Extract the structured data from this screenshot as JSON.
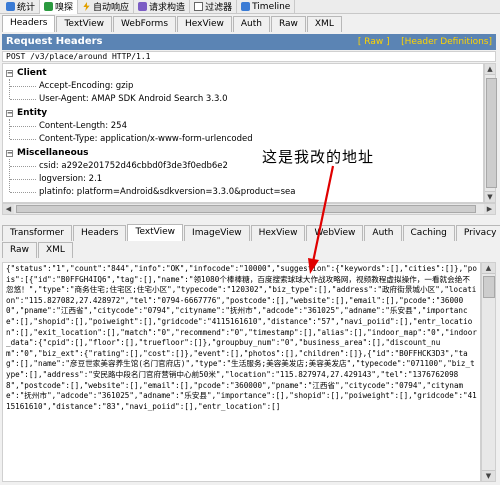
{
  "toolbar": {
    "items": [
      {
        "label": "统计",
        "icon": "stats-icon"
      },
      {
        "label": "嗅探",
        "icon": "inspect-icon",
        "active": true
      },
      {
        "label": "自动响应",
        "icon": "lightning-icon"
      },
      {
        "label": "请求构造",
        "icon": "composer-icon"
      },
      {
        "label": "过滤器",
        "icon": "checkbox-icon"
      },
      {
        "label": "Timeline",
        "icon": "timeline-icon"
      }
    ]
  },
  "request_tabs": [
    "Headers",
    "TextView",
    "WebForms",
    "HexView",
    "Auth",
    "Raw",
    "XML"
  ],
  "request_headers": {
    "title": "Request Headers",
    "raw_link": "[ Raw ]",
    "defs_link": "[Header Definitions]",
    "request_line": "POST /v3/place/around HTTP/1.1",
    "sections": [
      {
        "name": "Client",
        "items": [
          "Accept-Encoding: gzip",
          "User-Agent: AMAP SDK Android Search 3.3.0"
        ]
      },
      {
        "name": "Entity",
        "items": [
          "Content-Length: 254",
          "Content-Type: application/x-www-form-urlencoded"
        ]
      },
      {
        "name": "Miscellaneous",
        "items": [
          "csid: a292e201752d46cbbd0f3de3f0edb6e2",
          "logversion: 2.1",
          "platinfo: platform=Android&sdkversion=3.3.0&product=sea"
        ]
      }
    ]
  },
  "annotation": "这是我改的地址",
  "response_tabs_row1": [
    "Transformer",
    "Headers",
    "TextView",
    "ImageView",
    "HexView",
    "WebView",
    "Auth",
    "Caching",
    "Privacy"
  ],
  "response_tabs_row2": [
    "Raw",
    "XML"
  ],
  "response_body": "{\"status\":\"1\",\"count\":\"844\",\"info\":\"OK\",\"infocode\":\"10000\",\"suggestion\":{\"keywords\":[],\"cities\":[]},\"pois\":[{\"id\":\"B0FFGH4IQ6\",\"tag\":[],\"name\":\"领1080个棒棒糖，百度搜索球球大作战攻略网，视频教程虚拟操作，一看就会绝不忽悠！\",\"type\":\"商务住宅;住宅区;住宅小区\",\"typecode\":\"120302\",\"biz_type\":[],\"address\":\"政府街景城小区\",\"location\":\"115.827082,27.428972\",\"tel\":\"0794-6667776\",\"postcode\":[],\"website\":[],\"email\":[],\"pcode\":\"360000\",\"pname\":\"江西省\",\"citycode\":\"0794\",\"cityname\":\"抚州市\",\"adcode\":\"361025\",\"adname\":\"乐安县\",\"importance\":[],\"shopid\":[],\"poiweight\":[],\"gridcode\":\"4115161610\",\"distance\":\"57\",\"navi_poiid\":[],\"entr_location\":[],\"exit_location\":[],\"match\":\"0\",\"recommend\":\"0\",\"timestamp\":[],\"alias\":[],\"indoor_map\":\"0\",\"indoor_data\":{\"cpid\":[],\"floor\":[],\"truefloor\":[]},\"groupbuy_num\":\"0\",\"business_area\":[],\"discount_num\":\"0\",\"biz_ext\":{\"rating\":[],\"cost\":[]},\"event\":[],\"photos\":[],\"children\":[]},{\"id\":\"B0FFHCK3D3\",\"tag\":[],\"name\":\"彦豆世家美容养生馆(名门官府店)\",\"type\":\"生活服务;美容美发店;美容美发店\",\"typecode\":\"071100\",\"biz_type\":[],\"address\":\"安民路中段名门官府营销中心前50米\",\"location\":\"115.827974,27.429143\",\"tel\":\"13767620988\",\"postcode\":[],\"website\":[],\"email\":[],\"pcode\":\"360000\",\"pname\":\"江西省\",\"citycode\":\"0794\",\"cityname\":\"抚州市\",\"adcode\":\"361025\",\"adname\":\"乐安县\",\"importance\":[],\"shopid\":[],\"poiweight\":[],\"gridcode\":\"4115161610\",\"distance\":\"83\",\"navi_poiid\":[],\"entr_location\":[]"
}
